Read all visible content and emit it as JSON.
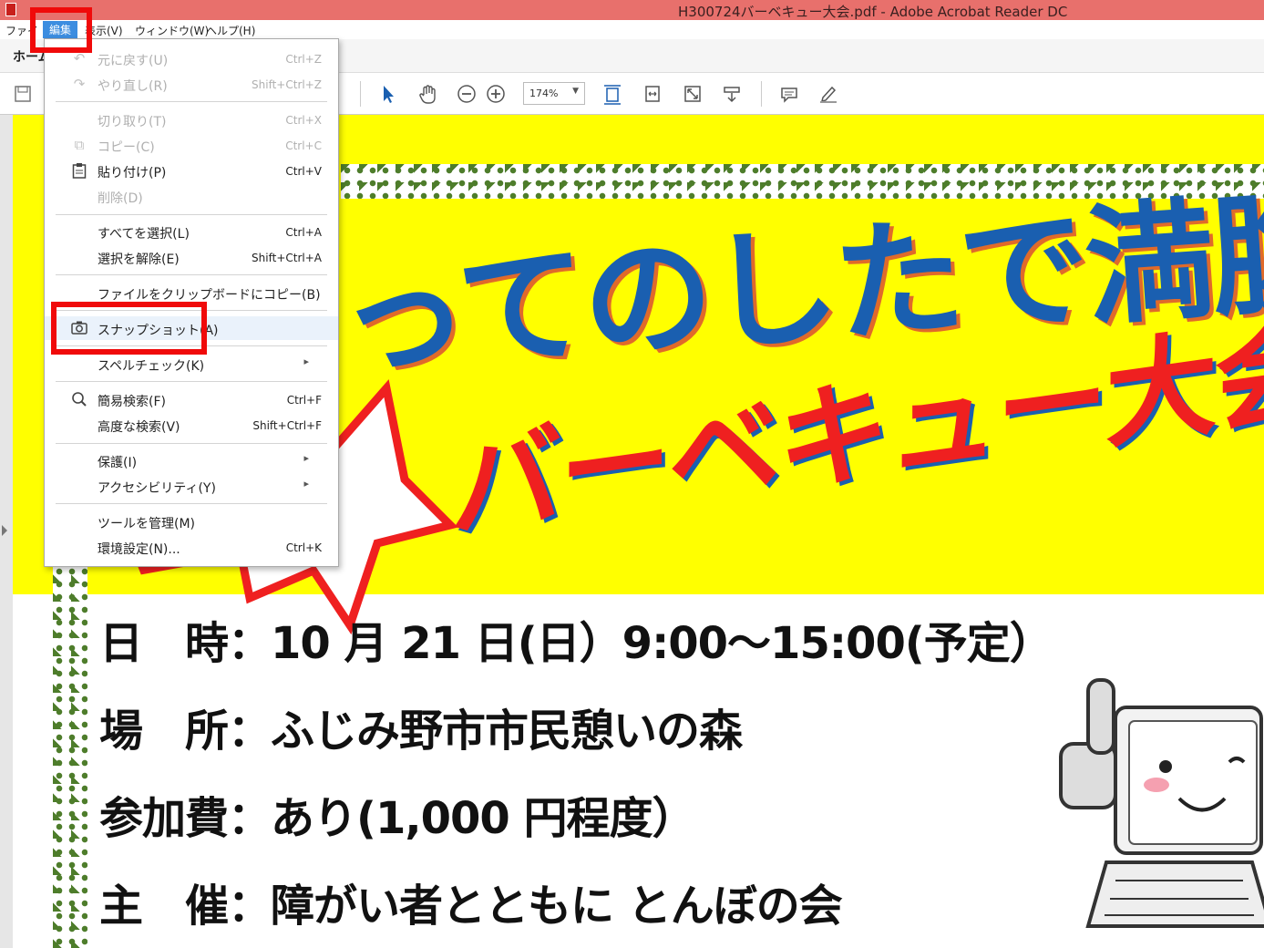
{
  "window": {
    "title": "H300724バーベキュー大会.pdf - Adobe Acrobat Reader DC"
  },
  "menubar": {
    "items": [
      "ファイル",
      "編集",
      "表示(V)",
      "ウィンドウ(W)",
      "ヘルプ(H)"
    ],
    "file_partial": "ファイ",
    "view_partial": "表示(V)"
  },
  "tabbar": {
    "home_partial": "ホーム"
  },
  "toolbar": {
    "zoom": "174%"
  },
  "edit_menu": {
    "items": [
      {
        "icon": "undo-icon",
        "label": "元に戻す(U)",
        "shortcut": "Ctrl+Z",
        "enabled": false
      },
      {
        "icon": "redo-icon",
        "label": "やり直し(R)",
        "shortcut": "Shift+Ctrl+Z",
        "enabled": false
      },
      {
        "icon": "",
        "label": "切り取り(T)",
        "shortcut": "Ctrl+X",
        "enabled": false
      },
      {
        "icon": "copy-icon",
        "label": "コピー(C)",
        "shortcut": "Ctrl+C",
        "enabled": false
      },
      {
        "icon": "paste-icon",
        "label": "貼り付け(P)",
        "shortcut": "Ctrl+V",
        "enabled": true
      },
      {
        "icon": "",
        "label": "削除(D)",
        "shortcut": "",
        "enabled": false
      },
      {
        "icon": "",
        "label": "すべてを選択(L)",
        "shortcut": "Ctrl+A",
        "enabled": true
      },
      {
        "icon": "",
        "label": "選択を解除(E)",
        "shortcut": "Shift+Ctrl+A",
        "enabled": true
      },
      {
        "icon": "",
        "label": "ファイルをクリップボードにコピー(B)",
        "shortcut": "",
        "enabled": true
      },
      {
        "icon": "camera-icon",
        "label": "スナップショット(A)",
        "shortcut": "",
        "enabled": true
      },
      {
        "icon": "",
        "label": "スペルチェック(K)",
        "shortcut": "",
        "enabled": true,
        "submenu": true
      },
      {
        "icon": "search-icon",
        "label": "簡易検索(F)",
        "shortcut": "Ctrl+F",
        "enabled": true
      },
      {
        "icon": "",
        "label": "高度な検索(V)",
        "shortcut": "Shift+Ctrl+F",
        "enabled": true
      },
      {
        "icon": "",
        "label": "保護(I)",
        "shortcut": "",
        "enabled": true,
        "submenu": true
      },
      {
        "icon": "",
        "label": "アクセシビリティ(Y)",
        "shortcut": "",
        "enabled": true,
        "submenu": true
      },
      {
        "icon": "",
        "label": "ツールを管理(M)",
        "shortcut": "",
        "enabled": true
      },
      {
        "icon": "",
        "label": "環境設定(N)...",
        "shortcut": "Ctrl+K",
        "enabled": true
      }
    ]
  },
  "document": {
    "headline": "ってのしたで満腹！",
    "subline": "バーベキュー大会",
    "lines": [
      "日　時：10 月 21 日(日）9:00〜15:00(予定）",
      "場　所：ふじみ野市市民憩いの森",
      "参加費：あり(1,000 円程度）",
      "主　催：障がい者とともに とんぼの会"
    ]
  },
  "colors": {
    "titlebar": "#e8706c",
    "menu_active": "#3c8de0",
    "highlight_box": "#f00a0a",
    "flyer_yellow": "#ffff00",
    "headline_blue": "#1a5fb0",
    "subline_red": "#ef2020"
  }
}
